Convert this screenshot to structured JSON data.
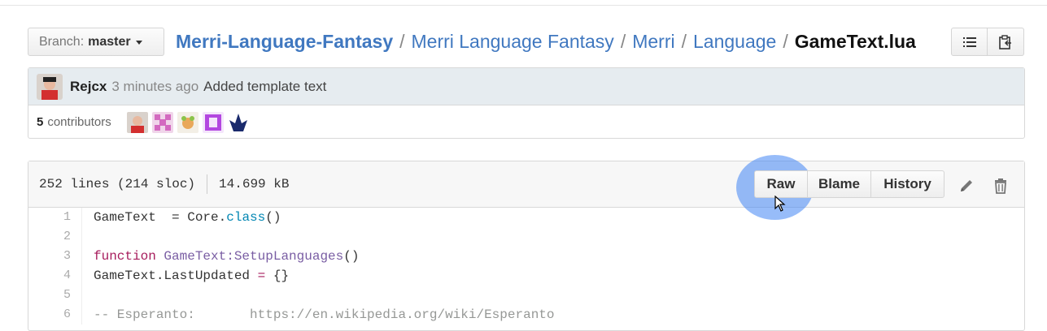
{
  "branch": {
    "prefix": "Branch:",
    "name": "master"
  },
  "breadcrumb": {
    "repo": "Merri-Language-Fantasy",
    "seg1": "Merri Language Fantasy",
    "seg2": "Merri",
    "seg3": "Language",
    "file": "GameText.lua",
    "sep": "/"
  },
  "commit": {
    "author": "Rejcx",
    "time": "3 minutes ago",
    "message": "Added template text"
  },
  "contributors": {
    "count": "5",
    "label": "contributors"
  },
  "file": {
    "lines": "252 lines (214 sloc)",
    "size": "14.699 kB",
    "raw_label": "Raw",
    "blame_label": "Blame",
    "history_label": "History"
  },
  "code": {
    "numbers": [
      "1",
      "2",
      "3",
      "4",
      "5",
      "6"
    ],
    "l1_a": "GameText  = Core.",
    "l1_b": "class",
    "l1_c": "()",
    "l3_a": "function",
    "l3_b": " GameText:SetupLanguages",
    "l3_c": "()",
    "l4_a": "GameText.LastUpdated ",
    "l4_b": "=",
    "l4_c": " {}",
    "l6": "-- Esperanto:       https://en.wikipedia.org/wiki/Esperanto"
  },
  "colors": {
    "link": "#4078c0",
    "highlight": "#4285f4",
    "keyword": "#a71d5d",
    "function": "#795da3",
    "builtin": "#0086b3",
    "comment": "#969896"
  }
}
